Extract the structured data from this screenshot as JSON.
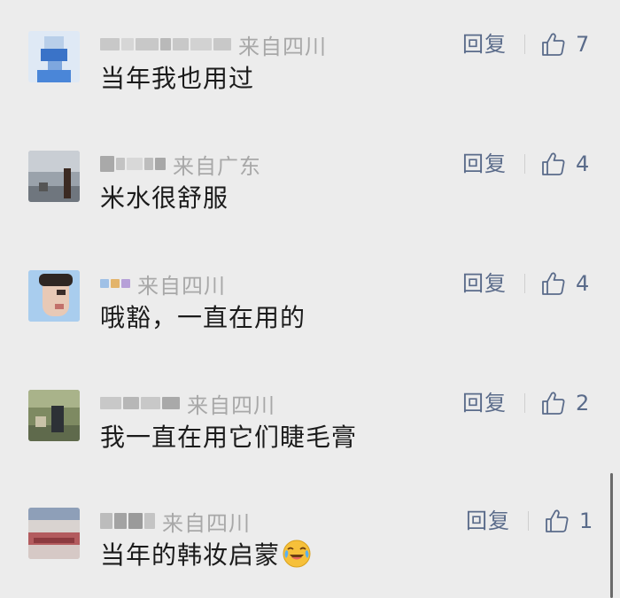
{
  "comments": [
    {
      "region": "来自四川",
      "text": "当年我也用过",
      "reply": "回复",
      "likes": "7"
    },
    {
      "region": "来自广东",
      "text": "米水很舒服",
      "reply": "回复",
      "likes": "4"
    },
    {
      "region": "来自四川",
      "text": "哦豁，一直在用的",
      "reply": "回复",
      "likes": "4"
    },
    {
      "region": "来自四川",
      "text": "我一直在用它们睫毛膏",
      "reply": "回复",
      "likes": "2"
    },
    {
      "region": "来自四川",
      "text": "当年的韩妆启蒙",
      "reply": "回复",
      "likes": "1"
    }
  ],
  "icons": {
    "like": "thumbs-up-icon",
    "emoji": "crying-laughing-emoji-icon"
  },
  "colors": {
    "background": "#ececec",
    "link": "#5a6b8a",
    "region": "#a8a8a8",
    "text": "#1b1b1b",
    "emoji": "#f6c03a"
  }
}
